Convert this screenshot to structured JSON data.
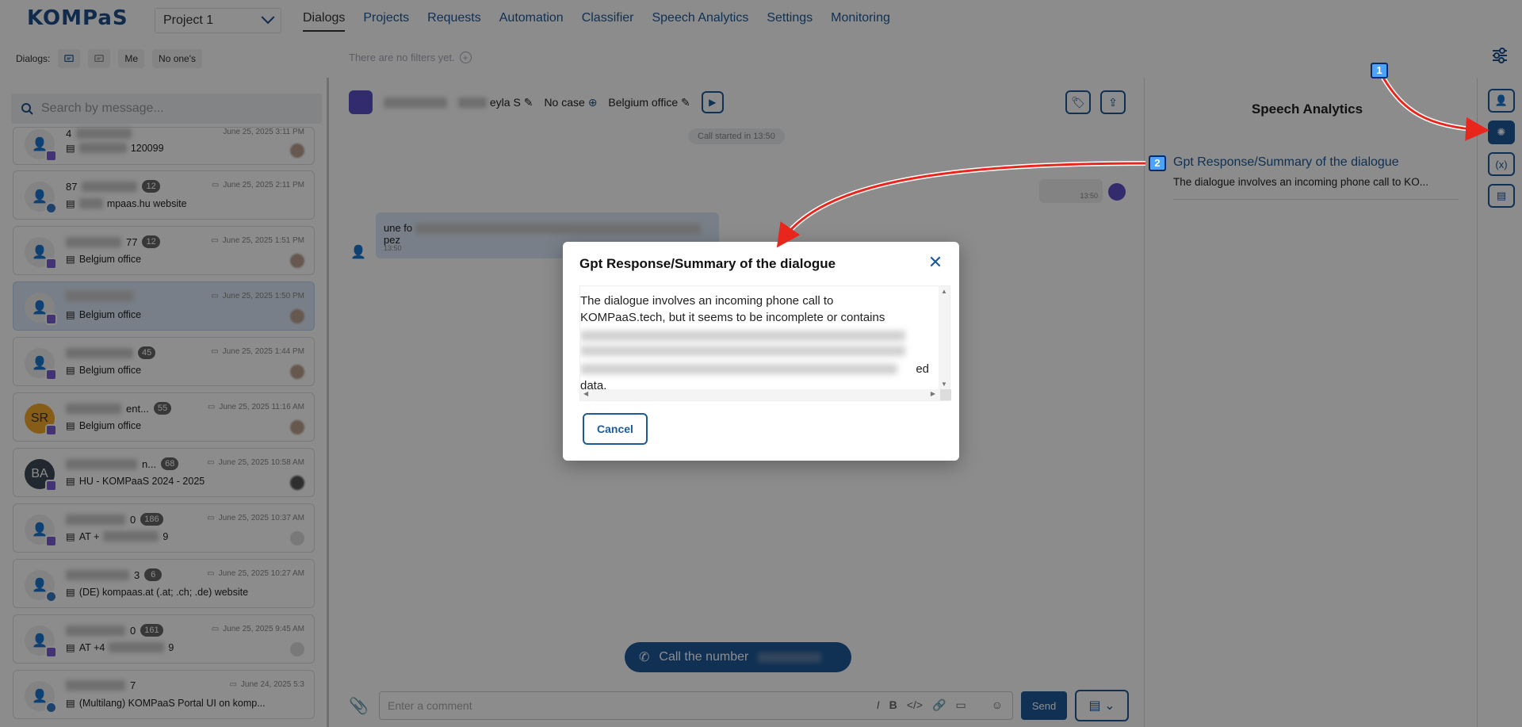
{
  "logo": "KOMPaS",
  "project": "Project 1",
  "nav": [
    "Dialogs",
    "Projects",
    "Requests",
    "Automation",
    "Classifier",
    "Speech Analytics",
    "Settings",
    "Monitoring"
  ],
  "filters": {
    "label": "Dialogs:",
    "me": "Me",
    "no_one": "No one's",
    "empty": "There are no filters yet."
  },
  "search_placeholder": "Search by message...",
  "dialogs": [
    {
      "name_suffix": "4",
      "badge": "",
      "time": "June 25, 2025 3:11 PM",
      "sub": "120099",
      "channel": "cloud"
    },
    {
      "name_suffix": "87",
      "badge": "12",
      "time": "June 25, 2025 2:11 PM",
      "sub": "mpaas.hu website",
      "channel": "web"
    },
    {
      "name_suffix": "77",
      "badge": "12",
      "time": "June 25, 2025 1:51 PM",
      "sub": "Belgium office",
      "channel": "cloud"
    },
    {
      "name_suffix": "",
      "badge": "",
      "time": "June 25, 2025 1:50 PM",
      "sub": "Belgium office",
      "channel": "cloud",
      "selected": true
    },
    {
      "name_suffix": "",
      "badge": "45",
      "time": "June 25, 2025 1:44 PM",
      "sub": "Belgium office",
      "channel": "cloud"
    },
    {
      "name_suffix": "ent...",
      "badge": "55",
      "time": "June 25, 2025 11:16 AM",
      "sub": "Belgium office",
      "channel": "cloud",
      "avatar": "SR"
    },
    {
      "name_suffix": "n...",
      "badge": "68",
      "time": "June 25, 2025 10:58 AM",
      "sub": "HU - KOMPaaS 2024 - 2025",
      "channel": "cloud",
      "avatar": "BA"
    },
    {
      "name_suffix": "0",
      "badge": "186",
      "time": "June 25, 2025 10:37 AM",
      "sub": "AT +",
      "channel": "cloud"
    },
    {
      "name_suffix": "3",
      "badge": "6",
      "time": "June 25, 2025 10:27 AM",
      "sub": "(DE) kompaas.at (.at; .ch; .de) website",
      "channel": "web"
    },
    {
      "name_suffix": "0",
      "badge": "161",
      "time": "June 25, 2025 9:45 AM",
      "sub": "AT +4",
      "channel": "cloud"
    },
    {
      "name_suffix": "7",
      "badge": "",
      "time": "June 24, 2025 5:3",
      "sub": "(Multilang) KOMPaaS Portal UI on komp...",
      "channel": "web"
    }
  ],
  "chat": {
    "contact": "eyla S",
    "case": "No case",
    "office": "Belgium office",
    "call_started": "Call started in 13:50",
    "agent_time": "13:50",
    "client_msg_start": "une fo",
    "client_msg_end": "pez",
    "client_time": "13:50",
    "call_button": "Call the number",
    "comment_placeholder": "Enter a comment",
    "send": "Send"
  },
  "right_panel": {
    "title": "Speech Analytics",
    "item_title": "Gpt Response/Summary of the dialogue",
    "item_text": "The dialogue involves an incoming phone call to KO..."
  },
  "modal": {
    "title": "Gpt Response/Summary of the dialogue",
    "text_line1": "The dialogue involves an incoming phone call to",
    "text_line2": "KOMPaaS.tech, but it seems to be incomplete or contains",
    "text_tail": "ed",
    "text_end": "data.",
    "cancel": "Cancel"
  },
  "markers": [
    "1",
    "2"
  ]
}
